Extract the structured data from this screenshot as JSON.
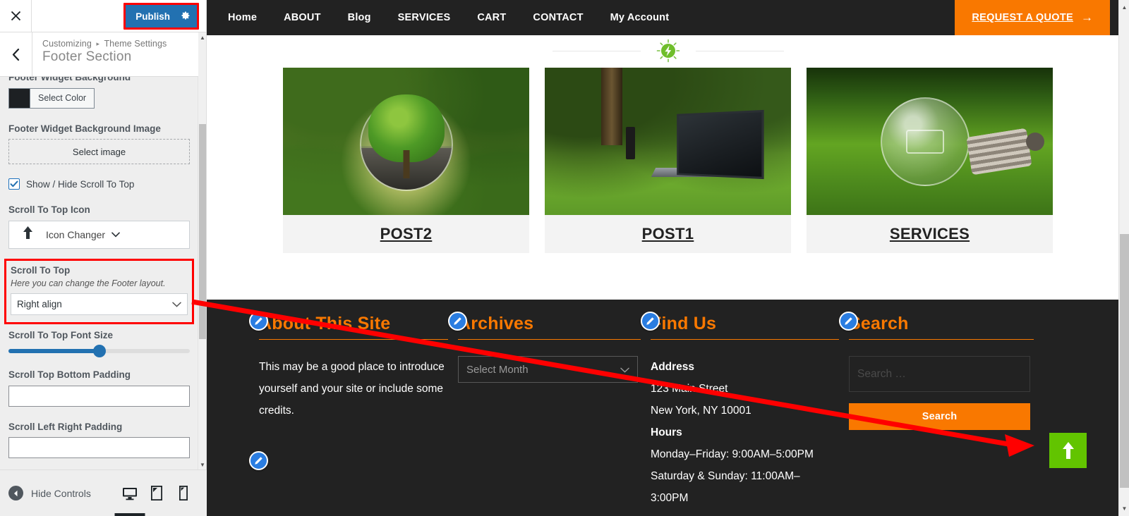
{
  "customizer": {
    "close_label": "×",
    "publish_label": "Publish",
    "gear_icon": "gear-icon",
    "back_icon": "chevron-left-icon",
    "breadcrumb_root": "Customizing",
    "breadcrumb_sep": "▸",
    "breadcrumb_parent": "Theme Settings",
    "section_title": "Footer Section",
    "controls": {
      "footer_widget_background_label": "Footer Widget Background",
      "select_color_label": "Select Color",
      "selected_color": "#1d2023",
      "footer_widget_bg_image_label": "Footer Widget Background Image",
      "select_image_label": "Select image",
      "show_hide_scroll_label": "Show / Hide Scroll To Top",
      "show_hide_scroll_checked": true,
      "scroll_icon_label": "Scroll To Top Icon",
      "icon_changer_label": "Icon Changer",
      "icon_changer_glyph": "↑",
      "scroll_to_top_label": "Scroll To Top",
      "scroll_to_top_desc": "Here you can change the Footer layout.",
      "scroll_to_top_value": "Right align",
      "font_size_label": "Scroll To Top Font Size",
      "font_size_percent": 50,
      "bottom_padding_label": "Scroll Top Bottom Padding",
      "bottom_padding_value": "",
      "left_right_padding_label": "Scroll Left Right Padding",
      "left_right_padding_value": ""
    },
    "bottom": {
      "hide_controls_label": "Hide Controls",
      "device_desktop": "desktop-icon",
      "device_tablet": "tablet-icon",
      "device_mobile": "mobile-icon"
    },
    "highlight_color": "#ff0000",
    "accent_color": "#2271b1"
  },
  "preview": {
    "nav": {
      "items": [
        {
          "label": "Home"
        },
        {
          "label": "ABOUT"
        },
        {
          "label": "Blog"
        },
        {
          "label": "SERVICES"
        },
        {
          "label": "CART"
        },
        {
          "label": "CONTACT"
        },
        {
          "label": "My Account"
        }
      ],
      "cta_label": "REQUEST A QUOTE",
      "cta_arrow": "→",
      "cta_color": "#f97800",
      "bar_color": "#222222"
    },
    "divider_icon": "sun-bolt-icon",
    "cards": [
      {
        "title": "POST2",
        "image": "tree-in-glass-globe"
      },
      {
        "title": "POST1",
        "image": "laptop-on-grass"
      },
      {
        "title": "SERVICES",
        "image": "light-bulb-on-grass"
      }
    ],
    "footer": {
      "background": "#222222",
      "accent": "#f97800",
      "widgets": [
        {
          "title": "About This Site",
          "text": "This may be a good place to introduce yourself and your site or include some credits."
        },
        {
          "title": "Archives",
          "select_value": "Select Month"
        },
        {
          "title": "Find Us",
          "address_heading": "Address",
          "address_line1": "123 Main Street",
          "address_line2": "New York, NY 10001",
          "hours_heading": "Hours",
          "hours_line1": "Monday–Friday: 9:00AM–5:00PM",
          "hours_line2": "Saturday & Sunday: 11:00AM–",
          "hours_line3": "3:00PM"
        },
        {
          "title": "Search",
          "search_placeholder": "Search …",
          "search_value": "",
          "search_button": "Search"
        }
      ],
      "scroll_top_color": "#62c400",
      "scroll_top_glyph": "↑"
    }
  }
}
